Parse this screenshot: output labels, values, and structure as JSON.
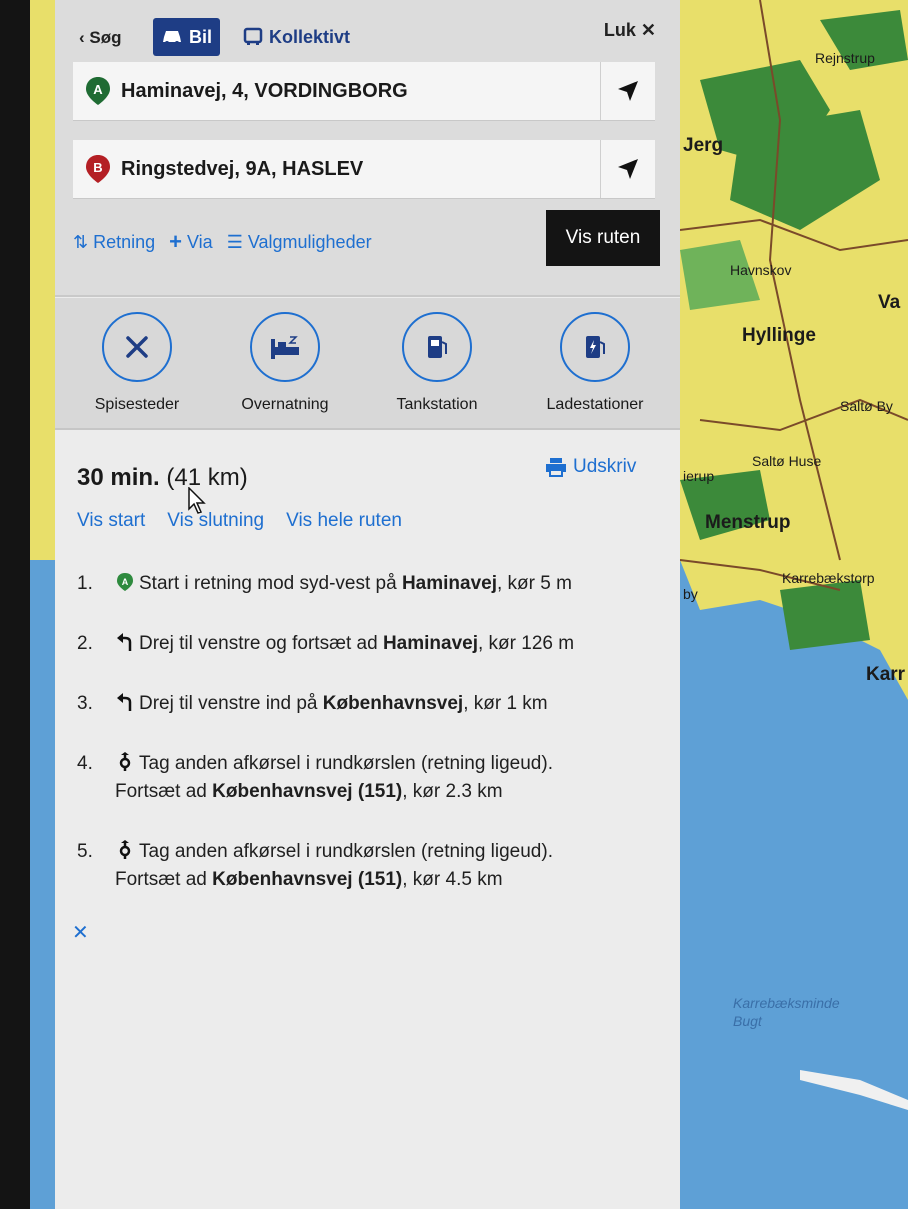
{
  "header": {
    "back_label": "Søg",
    "mode_car": "Bil",
    "mode_transit": "Kollektivt",
    "close_label": "Luk",
    "from": {
      "marker": "A",
      "address": "Haminavej, 4, VORDINGBORG",
      "marker_color": "#1f6b33"
    },
    "to": {
      "marker": "B",
      "address": "Ringstedvej, 9A, HASLEV",
      "marker_color": "#b41f24"
    },
    "options": {
      "direction": "Retning",
      "via": "Via",
      "settings": "Valgmuligheder"
    },
    "show_route": "Vis ruten"
  },
  "poi": [
    {
      "label": "Spisesteder",
      "icon": "fork-knife-icon"
    },
    {
      "label": "Overnatning",
      "icon": "bed-icon"
    },
    {
      "label": "Tankstation",
      "icon": "fuel-pump-icon"
    },
    {
      "label": "Ladestationer",
      "icon": "ev-charger-icon"
    }
  ],
  "summary": {
    "duration": "30 min.",
    "distance": "(41 km)",
    "print": "Udskriv",
    "view_start": "Vis start",
    "view_end": "Vis slutning",
    "view_all": "Vis hele ruten"
  },
  "steps": [
    {
      "num": "1.",
      "icon": "start-a-icon",
      "pre": "Start i retning mod syd-vest på ",
      "road": "Haminavej",
      "post": ", kør 5 m",
      "line2": ""
    },
    {
      "num": "2.",
      "icon": "turn-left-icon",
      "pre": "Drej til venstre og fortsæt ad ",
      "road": "Haminavej",
      "post": ", kør 126 m",
      "line2": ""
    },
    {
      "num": "3.",
      "icon": "turn-left-icon",
      "pre": "Drej til venstre ind på ",
      "road": "Københavnsvej",
      "post": ", kør 1 km",
      "line2": ""
    },
    {
      "num": "4.",
      "icon": "roundabout-icon",
      "pre": "Tag anden afkørsel i rundkørslen (retning ligeud).",
      "road": "",
      "post": "",
      "line2_pre": "Fortsæt ad ",
      "line2_road": "Københavnsvej (151)",
      "line2_post": ", kør 2.3 km"
    },
    {
      "num": "5.",
      "icon": "roundabout-icon",
      "pre": "Tag anden afkørsel i rundkørslen (retning ligeud).",
      "road": "",
      "post": "",
      "line2_pre": "Fortsæt ad ",
      "line2_road": "Københavnsvej (151)",
      "line2_post": ", kør 4.5 km"
    }
  ],
  "map_labels": {
    "rejnstrup": "Rejnstrup",
    "jerg": "Jerg",
    "havnskov": "Havnskov",
    "va": "Va",
    "hyllinge": "Hyllinge",
    "salto_by": "Saltø By",
    "salto_huse": "Saltø Huse",
    "erup": "ierup",
    "menstrup": "Menstrup",
    "karrebaekstorp": "Karrebækstorp",
    "by": "by",
    "karr": "Karr",
    "bugt1": "Karrebæksminde",
    "bugt2": "Bugt"
  },
  "colors": {
    "accent_blue": "#1e6fd0",
    "active_tab": "#1e3d85",
    "water": "#5ea0d6",
    "land": "#e8df6a",
    "forest": "#3c8a3a"
  }
}
